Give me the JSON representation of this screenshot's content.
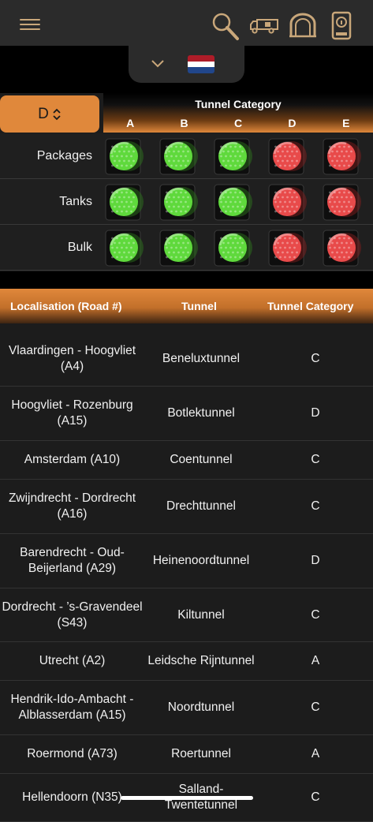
{
  "header": {
    "icons": [
      "menu-icon",
      "search-icon",
      "truck-icon",
      "tunnel-icon",
      "info-document-icon"
    ]
  },
  "language": {
    "flag_colors": [
      "#ae1c28",
      "#ffffff",
      "#21468b"
    ]
  },
  "category_selector": {
    "value": "D"
  },
  "tunnel_category": {
    "title": "Tunnel Category",
    "columns": [
      "A",
      "B",
      "C",
      "D",
      "E"
    ]
  },
  "light_rows": [
    {
      "label": "Packages",
      "lights": [
        "green",
        "green",
        "green",
        "red",
        "red"
      ]
    },
    {
      "label": "Tanks",
      "lights": [
        "green",
        "green",
        "green",
        "red",
        "red"
      ]
    },
    {
      "label": "Bulk",
      "lights": [
        "green",
        "green",
        "green",
        "red",
        "red"
      ]
    }
  ],
  "table": {
    "headers": {
      "location": "Localisation (Road #)",
      "tunnel": "Tunnel",
      "category": "Tunnel Category"
    },
    "rows": [
      {
        "location": "Vlaardingen - Hoogvliet (A4)",
        "tunnel": "Beneluxtunnel",
        "category": "C"
      },
      {
        "location": "Hoogvliet - Rozenburg (A15)",
        "tunnel": "Botlektunnel",
        "category": "D"
      },
      {
        "location": "Amsterdam (A10)",
        "tunnel": "Coentunnel",
        "category": "C"
      },
      {
        "location": "Zwijndrecht - Dordrecht (A16)",
        "tunnel": "Drechttunnel",
        "category": "C"
      },
      {
        "location": "Barendrecht - Oud-Beijerland (A29)",
        "tunnel": "Heinenoordtunnel",
        "category": "D"
      },
      {
        "location": "Dordrecht - ’s-Gravendeel (S43)",
        "tunnel": "Kiltunnel",
        "category": "C"
      },
      {
        "location": "Utrecht (A2)",
        "tunnel": "Leidsche Rijntunnel",
        "category": "A"
      },
      {
        "location": "Hendrik-Ido-Ambacht - Alblasserdam (A15)",
        "tunnel": "Noordtunnel",
        "category": "C"
      },
      {
        "location": "Roermond (A73)",
        "tunnel": "Roertunnel",
        "category": "A"
      },
      {
        "location": "Hellendoorn (N35)",
        "tunnel": "Salland-Twentetunnel",
        "category": "C"
      }
    ]
  },
  "colors": {
    "accent": "#e0883b",
    "green_light": "#5fd93c",
    "red_light": "#e84a4a"
  }
}
